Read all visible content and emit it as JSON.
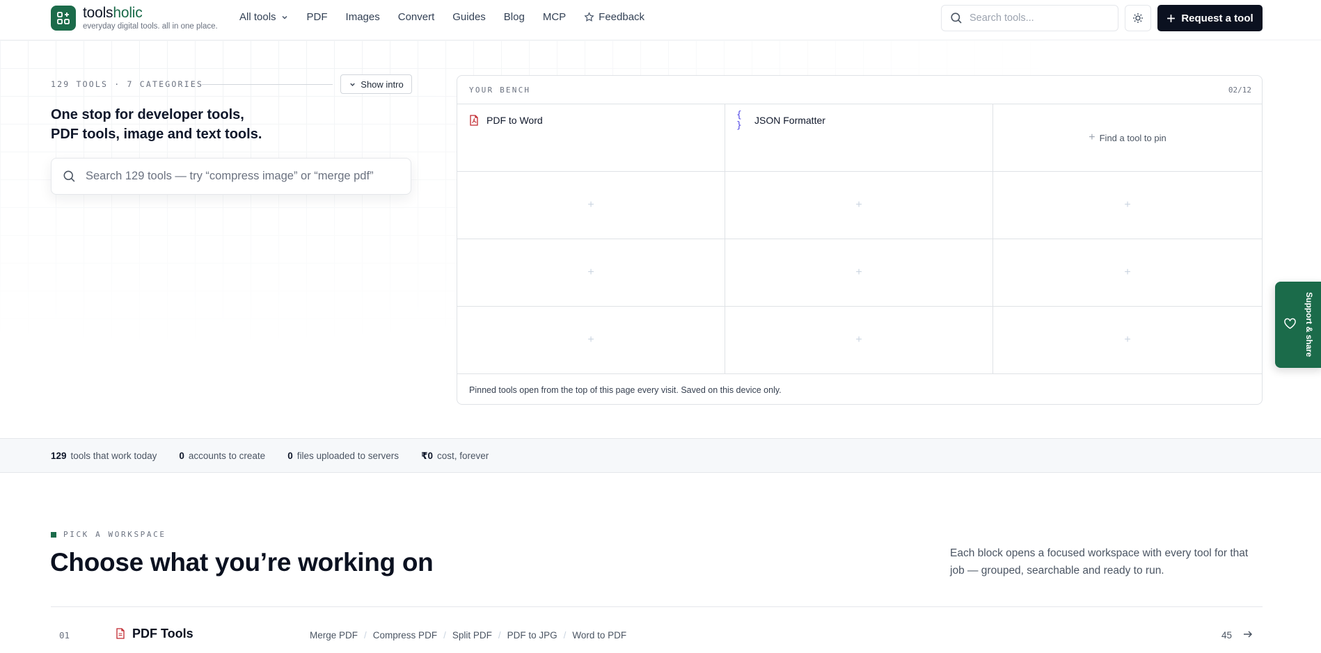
{
  "header": {
    "brand_part1": "tools",
    "brand_part2": "holic",
    "tagline": "everyday digital tools. all in one place.",
    "nav": {
      "all_tools": "All tools",
      "pdf": "PDF",
      "images": "Images",
      "convert": "Convert",
      "guides": "Guides",
      "blog": "Blog",
      "mcp": "MCP",
      "feedback": "Feedback"
    },
    "search_placeholder": "Search tools...",
    "request_label": "Request a tool",
    "icons": {
      "logo": "grid-plus-icon",
      "theme": "sun-icon",
      "search": "search-icon"
    }
  },
  "hero": {
    "count_text": "129 TOOLS · 7 CATEGORIES",
    "show_intro": "Show intro",
    "headline_line1": "One stop for developer tools,",
    "headline_line2": "PDF tools, image and text tools.",
    "search_placeholder": "Search 129 tools — try “compress image” or “merge pdf”"
  },
  "bench": {
    "title": "YOUR BENCH",
    "count": "02/12",
    "pinned": [
      {
        "label": "PDF to Word",
        "icon": "pdf-file-icon",
        "color": "#c0262d"
      },
      {
        "label": "JSON Formatter",
        "icon": "braces-icon",
        "color": "#4f46e5"
      }
    ],
    "find_label": "Find a tool to pin",
    "empty_slot": "+",
    "footer": "Pinned tools open from the top of this page every visit. Saved on this device only."
  },
  "support": {
    "label": "Support & share",
    "icon": "heart-icon"
  },
  "stats": [
    {
      "value": "129",
      "label": "tools that work today"
    },
    {
      "value": "0",
      "label": "accounts to create"
    },
    {
      "value": "0",
      "label": "files uploaded to servers"
    },
    {
      "value": "₹0",
      "label": "cost, forever"
    }
  ],
  "workspace": {
    "eyebrow": "PICK A WORKSPACE",
    "title": "Choose what you’re working on",
    "description": "Each block opens a focused workspace with every tool for that job — grouped, searchable and ready to run.",
    "rows": [
      {
        "num": "01",
        "name": "PDF Tools",
        "links": [
          "Merge PDF",
          "Compress PDF",
          "Split PDF",
          "PDF to JPG",
          "Word to PDF"
        ],
        "count": "45"
      }
    ]
  },
  "colors": {
    "brand": "#1b6b4a",
    "dark": "#0b1120",
    "pdf_red": "#c0262d"
  }
}
